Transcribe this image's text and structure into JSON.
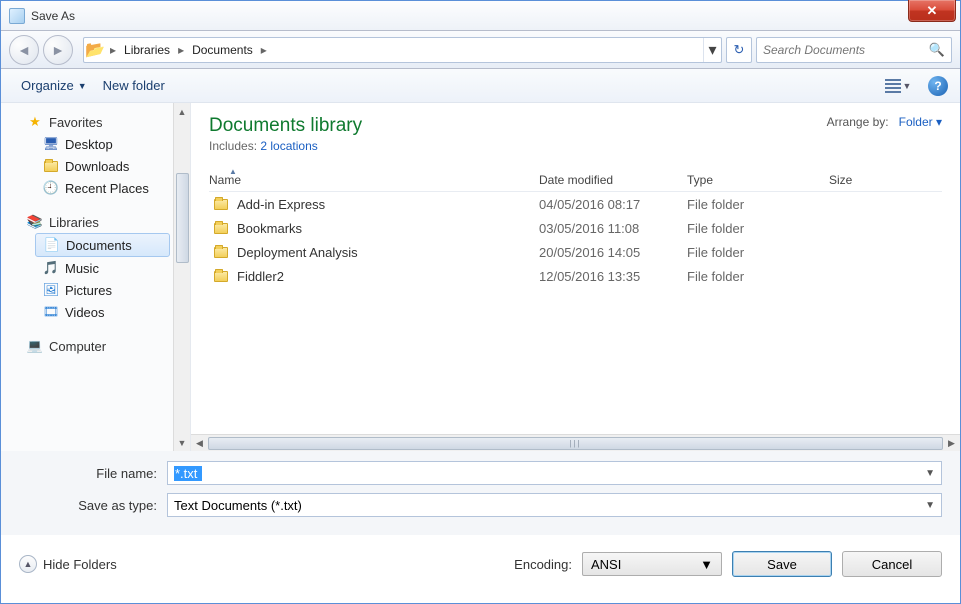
{
  "window": {
    "title": "Save As"
  },
  "breadcrumb": [
    "Libraries",
    "Documents"
  ],
  "search": {
    "placeholder": "Search Documents"
  },
  "toolbar": {
    "organize": "Organize",
    "newfolder": "New folder"
  },
  "sidebar": {
    "favorites": "Favorites",
    "fav_items": [
      "Desktop",
      "Downloads",
      "Recent Places"
    ],
    "libraries": "Libraries",
    "lib_items": [
      "Documents",
      "Music",
      "Pictures",
      "Videos"
    ],
    "computer": "Computer"
  },
  "library": {
    "title": "Documents library",
    "includes_label": "Includes:",
    "includes_link": "2 locations",
    "arrange_label": "Arrange by:",
    "arrange_value": "Folder"
  },
  "columns": [
    "Name",
    "Date modified",
    "Type",
    "Size"
  ],
  "rows": [
    {
      "name": "Add-in Express",
      "date": "04/05/2016 08:17",
      "type": "File folder"
    },
    {
      "name": "Bookmarks",
      "date": "03/05/2016 11:08",
      "type": "File folder"
    },
    {
      "name": "Deployment Analysis",
      "date": "20/05/2016 14:05",
      "type": "File folder"
    },
    {
      "name": "Fiddler2",
      "date": "12/05/2016 13:35",
      "type": "File folder"
    }
  ],
  "form": {
    "filename_label": "File name:",
    "filename_value": "*.txt",
    "saveastype_label": "Save as type:",
    "saveastype_value": "Text Documents (*.txt)"
  },
  "footer": {
    "hide_folders": "Hide Folders",
    "encoding_label": "Encoding:",
    "encoding_value": "ANSI",
    "save": "Save",
    "cancel": "Cancel"
  }
}
